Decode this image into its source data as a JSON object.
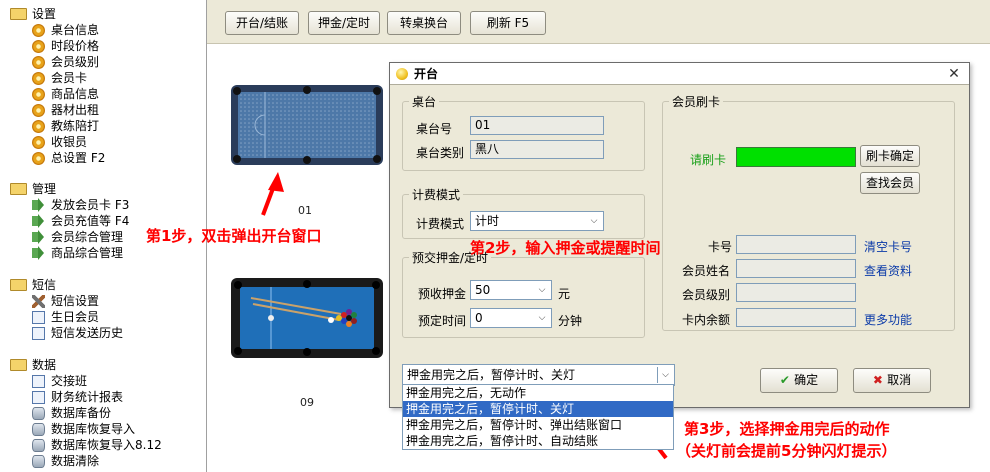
{
  "sidebar": {
    "groups": [
      {
        "label": "设置",
        "items": [
          "桌台信息",
          "时段价格",
          "会员级别",
          "会员卡",
          "商品信息",
          "器材出租",
          "教练陪打",
          "收银员",
          "总设置 F2"
        ]
      },
      {
        "label": "管理",
        "items": [
          "发放会员卡 F3",
          "会员充值等 F4",
          "会员综合管理",
          "商品综合管理"
        ]
      },
      {
        "label": "短信",
        "items": [
          "短信设置",
          "生日会员",
          "短信发送历史"
        ]
      },
      {
        "label": "数据",
        "items": [
          "交接班",
          "财务统计报表",
          "数据库备份",
          "数据库恢复导入",
          "数据库恢复导入8.12",
          "数据清除"
        ]
      }
    ]
  },
  "toolbar": {
    "open_label": "开台/结账",
    "deposit_label": "押金/定时",
    "transfer_label": "转桌换台",
    "refresh_label": "刷新 F5"
  },
  "tables": [
    {
      "label": "01",
      "style": "snooker"
    },
    {
      "label": "09",
      "style": "pool"
    }
  ],
  "annotations": {
    "step1": "第1步，双击弹出开台窗口",
    "step2": "第2步，输入押金或提醒时间",
    "step3_line1": "第3步，选择押金用完后的动作",
    "step3_line2": "（关灯前会提前5分钟闪灯提示）",
    "color": "#ff0000"
  },
  "dialog": {
    "title": "开台",
    "table_group": "桌台",
    "table_no_label": "桌台号",
    "table_no": "01",
    "table_type_label": "桌台类别",
    "table_type": "黑八",
    "billing_group": "计费模式",
    "billing_label": "计费模式",
    "billing_value": "计时",
    "prepay_group": "预交押金/定时",
    "deposit_label": "预收押金",
    "deposit_value": "50",
    "deposit_unit": "元",
    "timer_label": "预定时间",
    "timer_value": "0",
    "timer_unit": "分钟",
    "card_group": "会员刷卡",
    "swipe_label": "请刷卡",
    "swipe_confirm": "刷卡确定",
    "find_member": "查找会员",
    "card_no_label": "卡号",
    "clear_card": "清空卡号",
    "member_name_label": "会员姓名",
    "view_info": "查看资料",
    "member_level_label": "会员级别",
    "balance_label": "卡内余额",
    "more": "更多功能",
    "action_selected": "押金用完之后，暂停计时、关灯",
    "action_options": [
      "押金用完之后，无动作",
      "押金用完之后，暂停计时、关灯",
      "押金用完之后，暂停计时、弹出结账窗口",
      "押金用完之后，暂停计时、自动结账"
    ],
    "ok": "确定",
    "cancel": "取消",
    "swipe_color": "#00e000"
  }
}
